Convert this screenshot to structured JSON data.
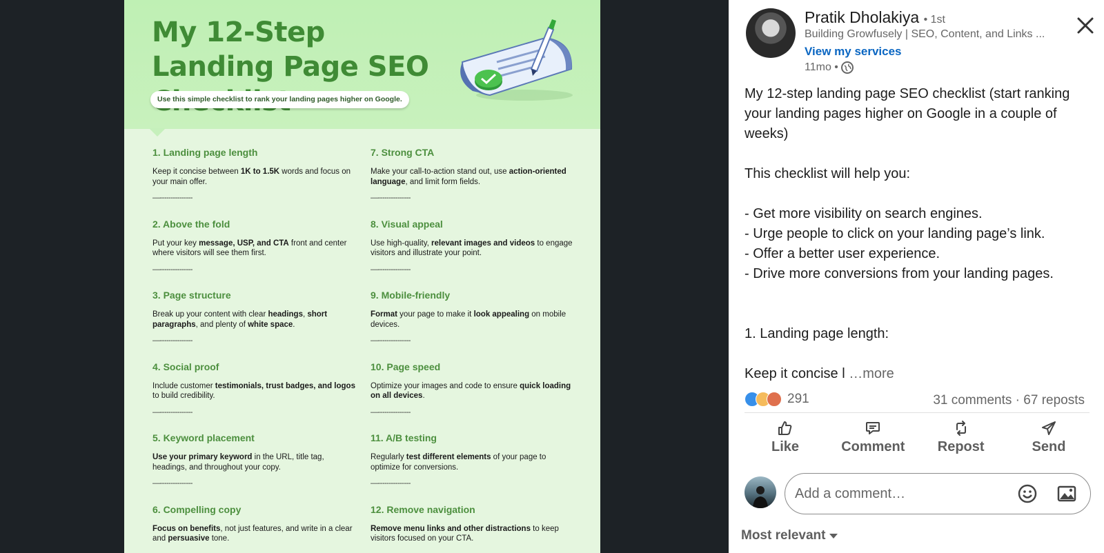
{
  "poster": {
    "title": "My 12-Step Landing Page SEO Checklist",
    "subtitle": "Use this simple checklist to rank your landing pages higher on Google.",
    "divider": "—---------------",
    "left_items": [
      {
        "heading": "1. Landing page length",
        "body": [
          [
            "Keep it concise between ",
            false
          ],
          [
            "1K to 1.5K",
            true
          ],
          [
            " words and focus on your main offer.",
            false
          ]
        ]
      },
      {
        "heading": "2. Above the fold",
        "body": [
          [
            "Put your key ",
            false
          ],
          [
            "message, USP, and CTA",
            true
          ],
          [
            " front and center where visitors will see them first.",
            false
          ]
        ]
      },
      {
        "heading": "3. Page structure",
        "body": [
          [
            "Break up your content with clear ",
            false
          ],
          [
            "headings",
            true
          ],
          [
            ", ",
            false
          ],
          [
            "short paragraphs",
            true
          ],
          [
            ", and plenty of ",
            false
          ],
          [
            "white space",
            true
          ],
          [
            ".",
            false
          ]
        ]
      },
      {
        "heading": "4. Social proof",
        "body": [
          [
            "Include customer ",
            false
          ],
          [
            "testimonials, trust badges, and logos",
            true
          ],
          [
            " to build credibility.",
            false
          ]
        ]
      },
      {
        "heading": "5. Keyword placement",
        "body": [
          [
            "Use your primary keyword",
            true
          ],
          [
            " in the URL, title tag, headings, and throughout your copy.",
            false
          ]
        ]
      },
      {
        "heading": "6. Compelling copy",
        "body": [
          [
            "Focus on benefits",
            true
          ],
          [
            ", not just features, and write in a clear and ",
            false
          ],
          [
            "persuasive",
            true
          ],
          [
            " tone.",
            false
          ]
        ]
      }
    ],
    "right_items": [
      {
        "heading": "7. Strong CTA",
        "body": [
          [
            "Make your call-to-action stand out, use ",
            false
          ],
          [
            "action-oriented language",
            true
          ],
          [
            ", and limit form fields.",
            false
          ]
        ]
      },
      {
        "heading": "8. Visual appeal",
        "body": [
          [
            "Use high-quality, ",
            false
          ],
          [
            "relevant images and videos",
            true
          ],
          [
            " to engage visitors and illustrate your point.",
            false
          ]
        ]
      },
      {
        "heading": "9. Mobile-friendly",
        "body": [
          [
            "Format",
            true
          ],
          [
            " your page to make it ",
            false
          ],
          [
            "look appealing",
            true
          ],
          [
            " on mobile devices.",
            false
          ]
        ]
      },
      {
        "heading": "10. Page speed",
        "body": [
          [
            "Optimize your images and code to ensure ",
            false
          ],
          [
            "quick loading on all devices",
            true
          ],
          [
            ".",
            false
          ]
        ]
      },
      {
        "heading": "11. A/B testing",
        "body": [
          [
            "Regularly ",
            false
          ],
          [
            "test different elements",
            true
          ],
          [
            " of your page to optimize for conversions.",
            false
          ]
        ]
      },
      {
        "heading": "12. Remove navigation",
        "body": [
          [
            "Remove menu links and other distractions",
            true
          ],
          [
            " to keep visitors focused on your CTA.",
            false
          ]
        ]
      }
    ]
  },
  "author": {
    "name": "Pratik Dholakiya",
    "degree": "• 1st",
    "headline": "Building Growfusely | SEO, Content, and Links ...",
    "services_link": "View my services",
    "time": "11mo •"
  },
  "post": {
    "lines": [
      "My 12-step landing page SEO checklist (start ranking",
      "your landing pages higher on Google in a couple of",
      "weeks)",
      "",
      "This checklist will help you:",
      "",
      "- Get more visibility on search engines.",
      "- Urge people to click on your landing page’s link.",
      "- Offer a better user experience.",
      "- Drive more conversions from your landing pages.",
      "",
      "",
      "1. Landing page length:",
      ""
    ],
    "truncated_line": "Keep it concise l",
    "more_label": "…more"
  },
  "social": {
    "reaction_count": "291",
    "comments_reposts": "31 comments · 67 reposts"
  },
  "actions": {
    "like": "Like",
    "comment": "Comment",
    "repost": "Repost",
    "send": "Send"
  },
  "comment_input": {
    "placeholder": "Add a comment…"
  },
  "sort": {
    "label": "Most relevant"
  },
  "colors": {
    "accent_green": "#4c8f3e",
    "link_blue": "#0a66c2"
  }
}
